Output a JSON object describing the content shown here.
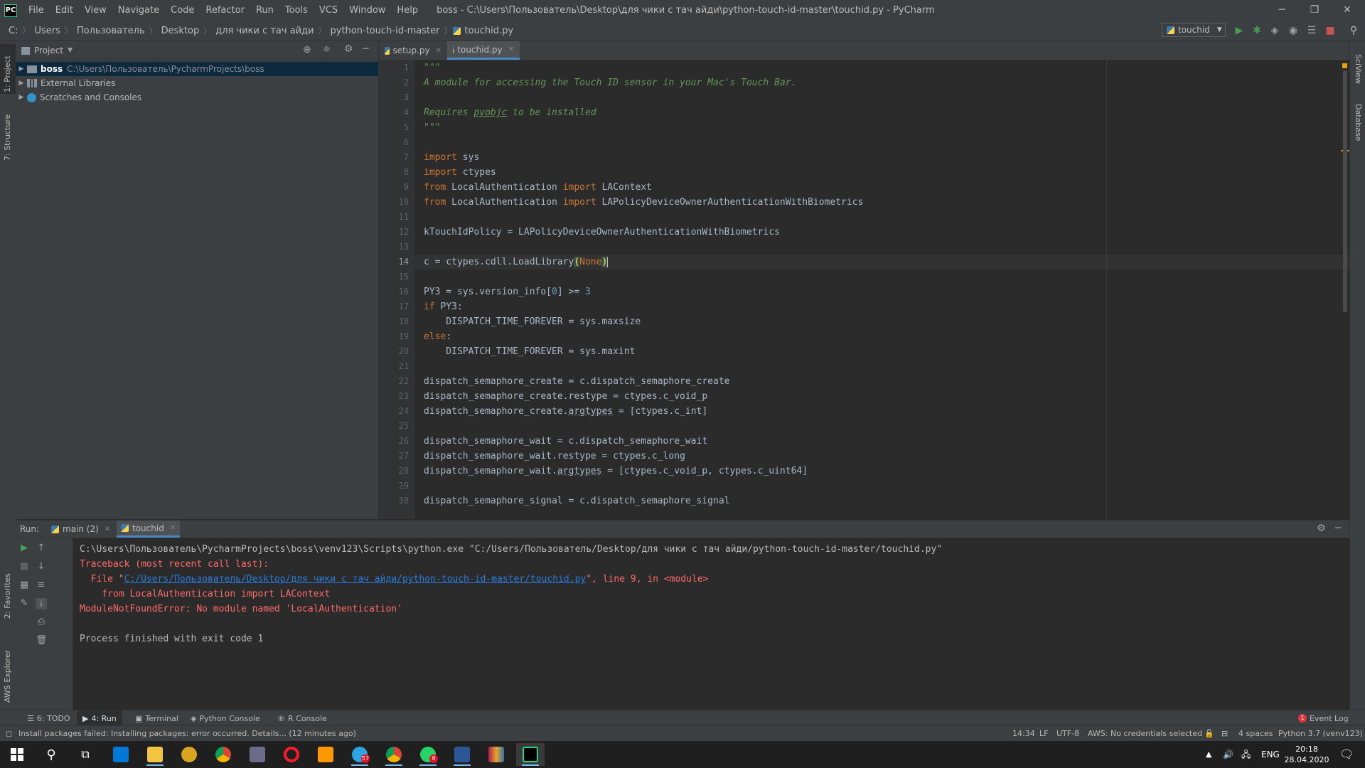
{
  "titlebar": {
    "logo": "PC",
    "menu": [
      "File",
      "Edit",
      "View",
      "Navigate",
      "Code",
      "Refactor",
      "Run",
      "Tools",
      "VCS",
      "Window",
      "Help"
    ],
    "title": "boss - C:\\Users\\Пользователь\\Desktop\\для чики с тач айди\\python-touch-id-master\\touchid.py - PyCharm",
    "controls": {
      "minimize": "─",
      "maximize": "❐",
      "close": "✕"
    }
  },
  "navbar": {
    "crumbs": [
      "C:",
      "Users",
      "Пользователь",
      "Desktop",
      "для чики с тач айди",
      "python-touch-id-master",
      "touchid.py"
    ],
    "run_config": "touchid"
  },
  "left_strip": {
    "project": "1: Project",
    "structure": "7: Structure",
    "favorites": "2: Favorites",
    "aws": "AWS Explorer"
  },
  "right_strip": {
    "sciview": "SciView",
    "database": "Database"
  },
  "project": {
    "title": "Project",
    "tree": [
      {
        "name": "boss",
        "path": "C:\\Users\\Пользователь\\PycharmProjects\\boss"
      },
      {
        "name": "External Libraries",
        "path": ""
      },
      {
        "name": "Scratches and Consoles",
        "path": ""
      }
    ]
  },
  "editor": {
    "tabs": [
      {
        "label": "setup.py"
      },
      {
        "label": "touchid.py"
      }
    ],
    "line_numbers": [
      "1",
      "2",
      "3",
      "4",
      "5",
      "6",
      "7",
      "8",
      "9",
      "10",
      "11",
      "12",
      "13",
      "14",
      "15",
      "16",
      "17",
      "18",
      "19",
      "20",
      "21",
      "22",
      "23",
      "24",
      "25",
      "26",
      "27",
      "28",
      "29",
      "30"
    ],
    "current_line": "14"
  },
  "code": {
    "l1": "\"\"\"",
    "l2": "A module for accessing the Touch ID sensor in your Mac's Touch Bar.",
    "l4a": "Requires ",
    "l4b": "pyobjc",
    "l4c": " to be installed",
    "l5": "\"\"\"",
    "kw_import": "import",
    "kw_from": "from",
    "sys": " sys",
    "ctypes": " ctypes",
    "la": " LocalAuthentication ",
    "lacontext": " LAContext",
    "lapolicy": " LAPolicyDeviceOwnerAuthenticationWithBiometrics",
    "l12": "kTouchIdPolicy = LAPolicyDeviceOwnerAuthenticationWithBiometrics",
    "l14a": "c = ctypes.cdll.LoadLibrary",
    "l14p1": "(",
    "l14none": "None",
    "l14p2": ")",
    "l16a": "PY3 = sys.version_info[",
    "l16n0": "0",
    "l16b": "] >= ",
    "l16n3": "3",
    "kw_if": "if",
    "l17": " PY3:",
    "l18": "    DISPATCH_TIME_FOREVER = sys.maxsize",
    "kw_else": "else",
    "colon": ":",
    "l20": "    DISPATCH_TIME_FOREVER = sys.maxint",
    "l22": "dispatch_semaphore_create = c.dispatch_semaphore_create",
    "l23": "dispatch_semaphore_create.restype = ctypes.c_void_p",
    "l24a": "dispatch_semaphore_create.",
    "argtypes": "argtypes",
    "l24b": " = [ctypes.c_int]",
    "l26": "dispatch_semaphore_wait = c.dispatch_semaphore_wait",
    "l27": "dispatch_semaphore_wait.restype = ctypes.c_long",
    "l28a": "dispatch_semaphore_wait.",
    "l28b": " = [ctypes.c_void_p, ctypes.c_uint64]",
    "l30": "dispatch_semaphore_signal = c.dispatch_semaphore_signal"
  },
  "run": {
    "label": "Run:",
    "tabs": [
      {
        "label": "main (2)"
      },
      {
        "label": "touchid"
      }
    ],
    "console": {
      "cmd": "C:\\Users\\Пользователь\\PycharmProjects\\boss\\venv123\\Scripts\\python.exe \"C:/Users/Пользователь/Desktop/для чики с тач айди/python-touch-id-master/touchid.py\"",
      "traceback": "Traceback (most recent call last):",
      "file_prefix": "  File \"",
      "file_link": "C:/Users/Пользователь/Desktop/для чики с тач айди/python-touch-id-master/touchid.py",
      "file_suffix": "\", line 9, in <module>",
      "from_line": "    from LocalAuthentication import LAContext",
      "error": "ModuleNotFoundError: No module named 'LocalAuthentication'",
      "finished": "Process finished with exit code 1"
    }
  },
  "bottom_tabs": [
    {
      "label": "6: TODO"
    },
    {
      "label": "4: Run"
    },
    {
      "label": "Terminal"
    },
    {
      "label": "Python Console"
    },
    {
      "label": "R Console"
    }
  ],
  "event_log": {
    "label": "Event Log",
    "count": "1"
  },
  "status": {
    "message": "Install packages failed: Installing packages: error occurred. Details... (12 minutes ago)",
    "position": "14:34",
    "line_sep": "LF",
    "encoding": "UTF-8",
    "aws": "AWS: No credentials selected",
    "indent": "4 spaces",
    "interpreter": "Python 3.7 (venv123)"
  },
  "taskbar": {
    "lang": "ENG",
    "time": "20:18",
    "date": "28.04.2020",
    "telegram_badge": "57",
    "whatsapp_badge": "8"
  }
}
